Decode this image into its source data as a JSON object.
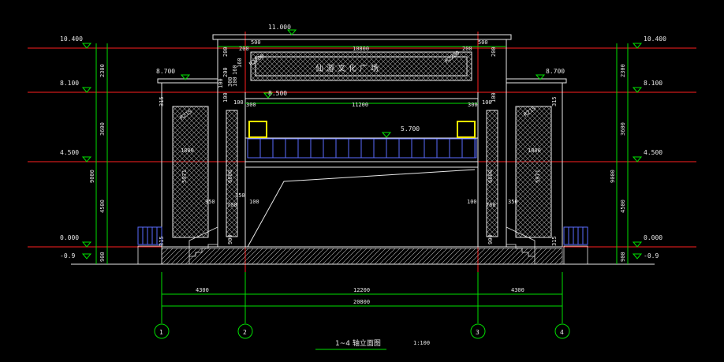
{
  "colors": {
    "background": "#000000",
    "grid_red": "#ff2020",
    "dim_green": "#00e000",
    "structure_white": "#e8e8e8",
    "railing_blue": "#5a6cff",
    "window_yellow": "#ffee00"
  },
  "levels_left": [
    "10.400",
    "8.100",
    "4.500",
    "0.000",
    "-0.9"
  ],
  "levels_right": [
    "10.400",
    "8.100",
    "4.500",
    "0.000",
    "-0.9"
  ],
  "side_eave_levels": [
    "8.700",
    "8.700"
  ],
  "roof_top_dim": "11.000",
  "mid_levels": [
    "8.500",
    "5.700"
  ],
  "vertical_dims_left": [
    "2300",
    "3600",
    "4500",
    "900",
    "9000"
  ],
  "vertical_dims_right": [
    "2300",
    "3600",
    "4500",
    "900",
    "9000"
  ],
  "sign_text": "仙游文化广场",
  "top_dims": [
    "500",
    "10800",
    "500",
    "200",
    "200"
  ],
  "inner_dims": [
    "11200",
    "300",
    "300",
    "100",
    "100"
  ],
  "arc_labels": [
    "R2200",
    "R2200",
    "R215",
    "R215"
  ],
  "pier_dims": [
    "1800",
    "1800",
    "5971",
    "5971",
    "6600",
    "6600",
    "350",
    "350",
    "350",
    "700",
    "760",
    "100",
    "100",
    "315",
    "315",
    "315",
    "315",
    "900",
    "900",
    "200",
    "200",
    "100",
    "100",
    "100",
    "160"
  ],
  "stack_dims": [
    "200",
    "300",
    "100",
    "160"
  ],
  "bottom_dims": [
    "4300",
    "12200",
    "4300",
    "20800"
  ],
  "axis_labels": [
    "1",
    "2",
    "3",
    "4"
  ],
  "title": "1~4 轴立面图",
  "scale": "1:100"
}
